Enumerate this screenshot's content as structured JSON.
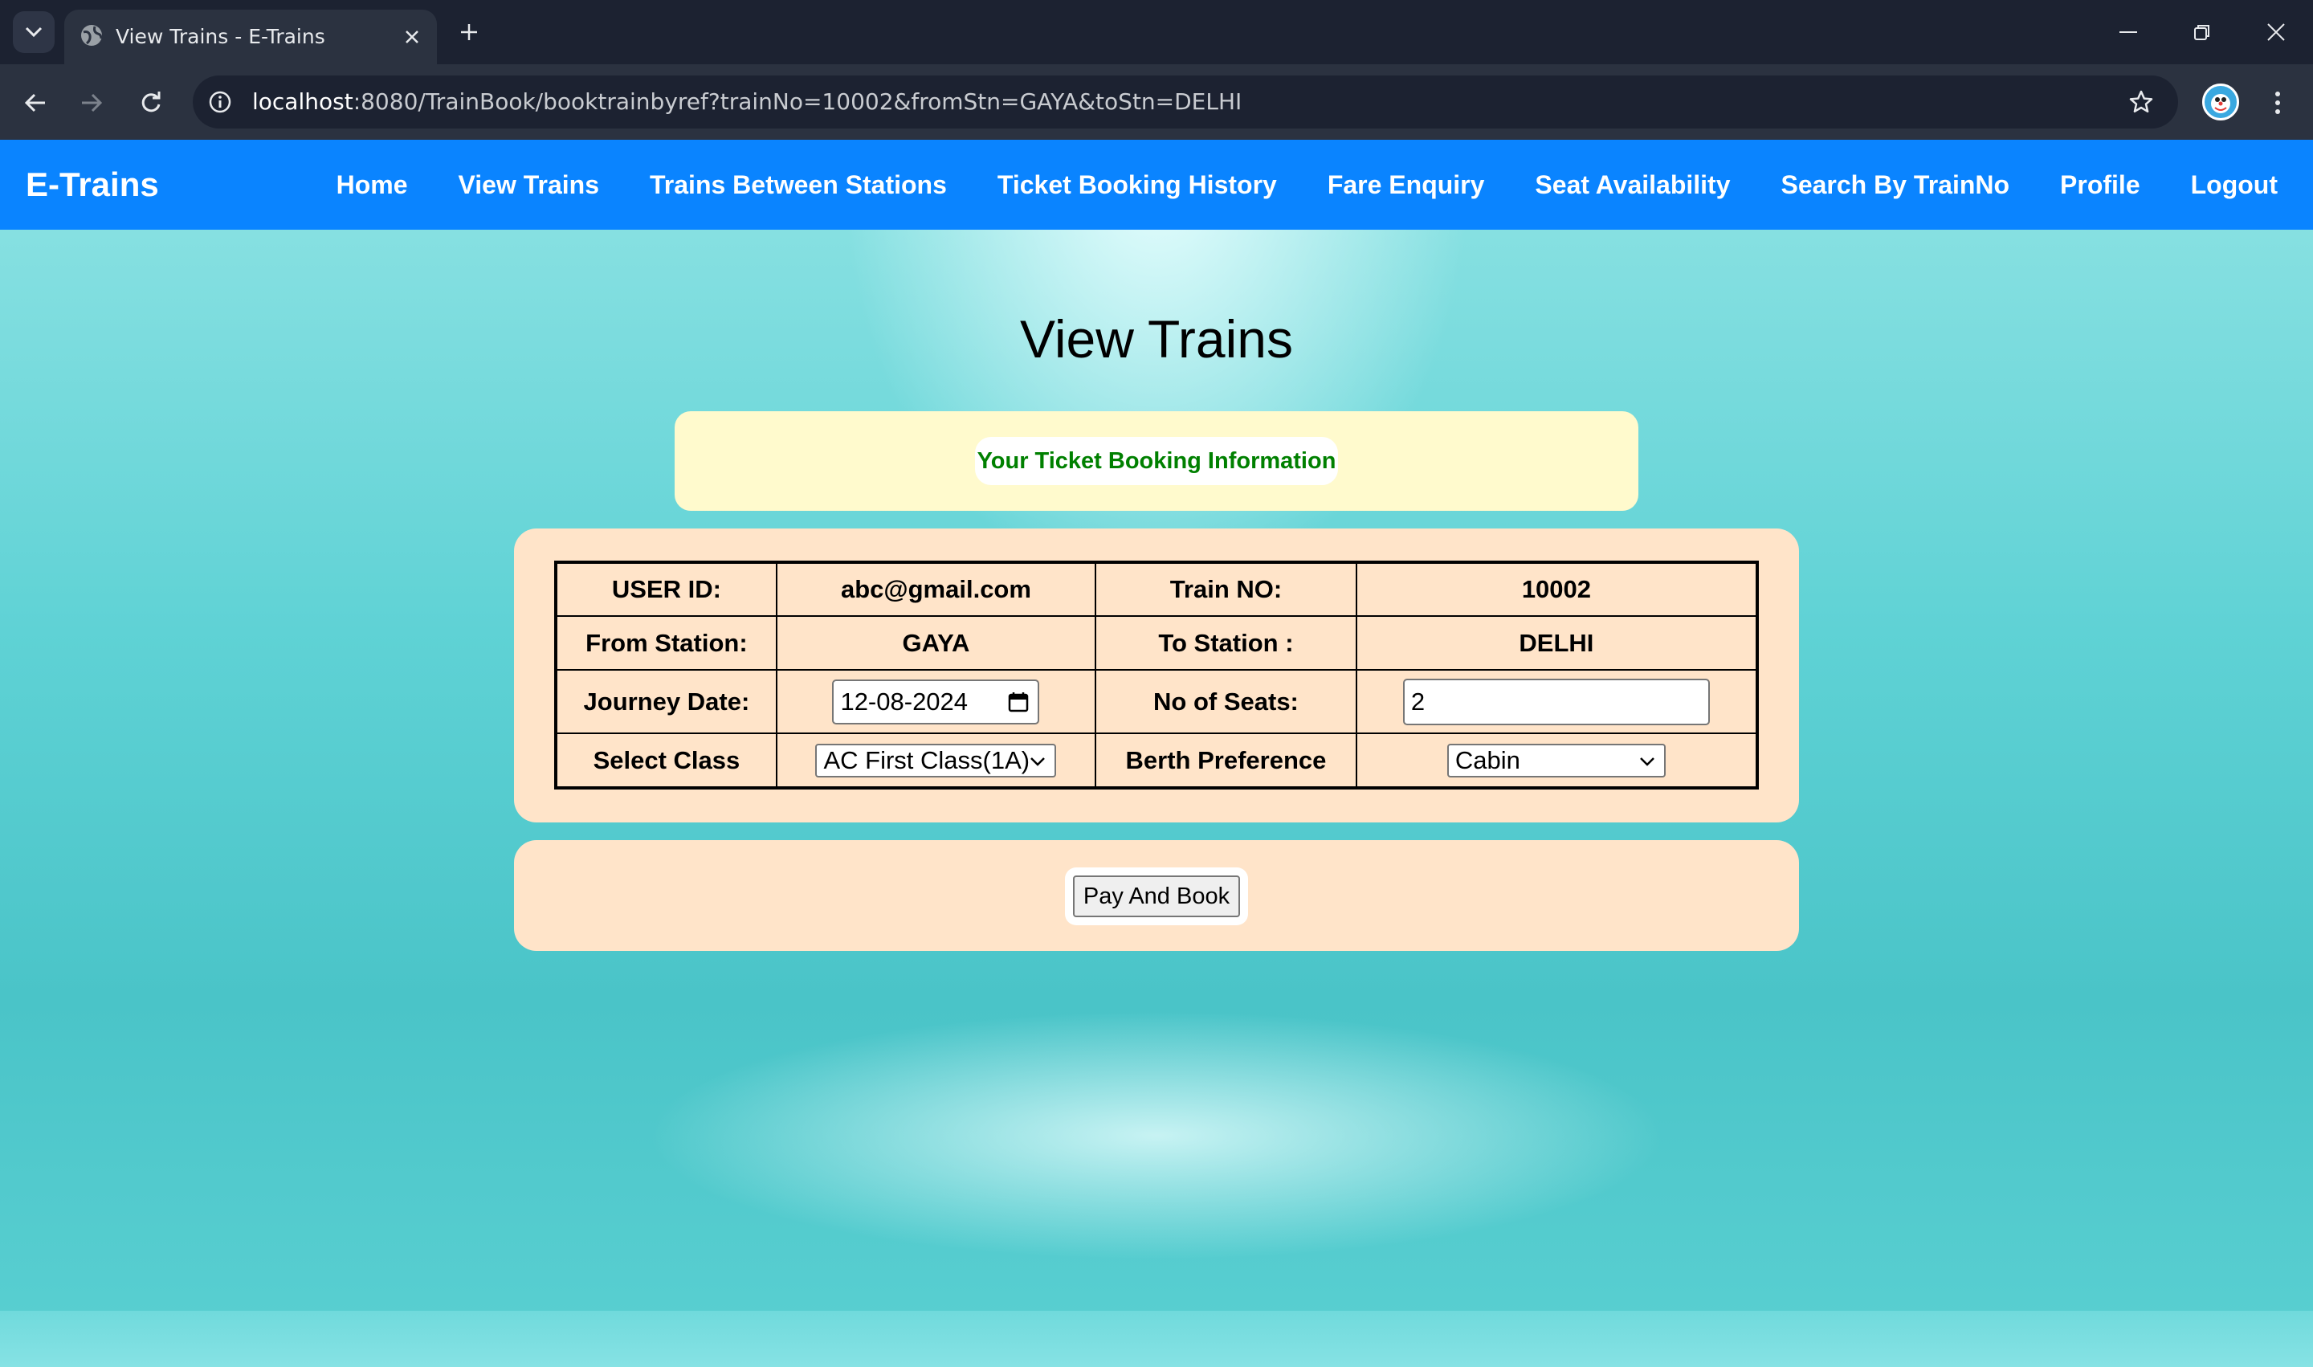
{
  "browser": {
    "tab_title": "View Trains - E-Trains",
    "url_host": "localhost",
    "url_rest": ":8080/TrainBook/booktrainbyref?trainNo=10002&fromStn=GAYA&toStn=DELHI"
  },
  "navbar": {
    "brand": "E-Trains",
    "links": [
      "Home",
      "View Trains",
      "Trains Between Stations",
      "Ticket Booking History",
      "Fare Enquiry",
      "Seat Availability",
      "Search By TrainNo",
      "Profile",
      "Logout"
    ]
  },
  "page": {
    "heading": "View Trains",
    "info_message": "Your Ticket Booking Information"
  },
  "booking": {
    "user_id_label": "USER ID:",
    "user_id": "abc@gmail.com",
    "train_no_label": "Train NO:",
    "train_no": "10002",
    "from_label": "From Station:",
    "from_station": "GAYA",
    "to_label": "To Station :",
    "to_station": "DELHI",
    "journey_date_label": "Journey Date:",
    "journey_date": "12-08-2024",
    "seats_label": "No of Seats:",
    "seats": "2",
    "class_label": "Select Class",
    "class_value": "AC First Class(1A)",
    "berth_label": "Berth Preference",
    "berth_value": "Cabin"
  },
  "actions": {
    "pay_button": "Pay And Book"
  },
  "colors": {
    "navbar": "#0a84ff",
    "info_text": "#008000",
    "info_box": "#fffacd",
    "form_box": "#ffe4c9"
  },
  "icons": [
    "tab-search-icon",
    "globe-icon",
    "close-icon",
    "plus-icon",
    "minimize-icon",
    "restore-icon",
    "window-close-icon",
    "back-arrow-icon",
    "forward-arrow-icon",
    "reload-icon",
    "site-info-icon",
    "bookmark-star-icon",
    "profile-avatar-icon",
    "more-menu-icon",
    "calendar-icon",
    "chevron-down-icon"
  ]
}
